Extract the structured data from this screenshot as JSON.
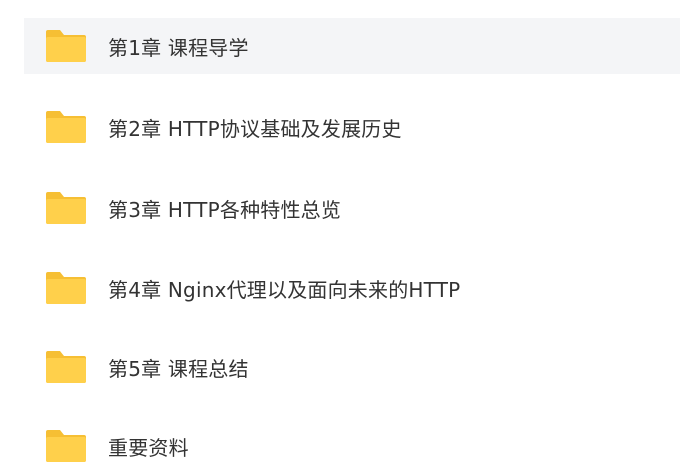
{
  "colors": {
    "folder_yellow": "#ffd04b",
    "folder_tab": "#f6bf34",
    "row_highlight": "#f4f5f7",
    "text": "#333333"
  },
  "items": [
    {
      "name": "第1章 课程导学",
      "icon": "folder-icon",
      "selected": true
    },
    {
      "name": "第2章 HTTP协议基础及发展历史",
      "icon": "folder-icon",
      "selected": false
    },
    {
      "name": "第3章 HTTP各种特性总览",
      "icon": "folder-icon",
      "selected": false
    },
    {
      "name": "第4章 Nginx代理以及面向未来的HTTP",
      "icon": "folder-icon",
      "selected": false
    },
    {
      "name": "第5章 课程总结",
      "icon": "folder-icon",
      "selected": false
    },
    {
      "name": "重要资料",
      "icon": "folder-icon",
      "selected": false
    }
  ]
}
